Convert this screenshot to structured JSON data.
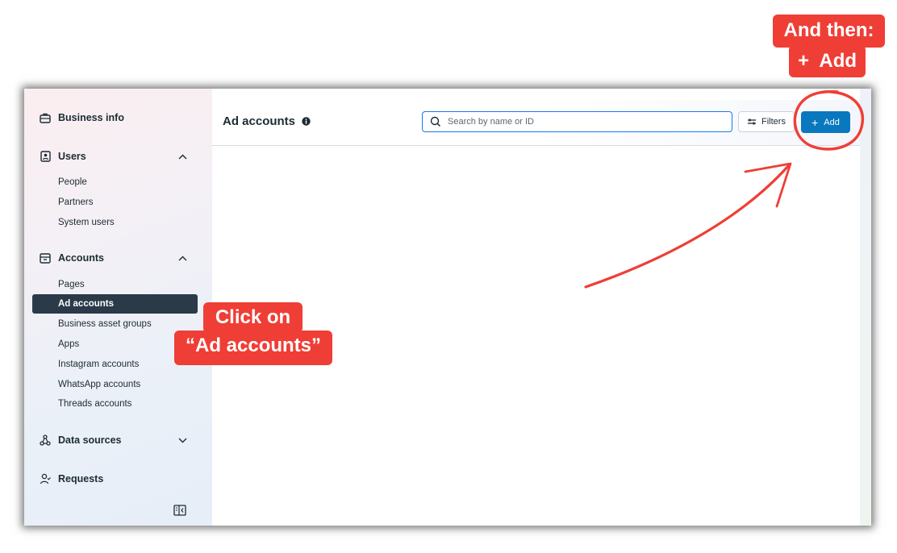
{
  "sidebar": {
    "business_info": "Business info",
    "users": {
      "label": "Users",
      "items": [
        "People",
        "Partners",
        "System users"
      ]
    },
    "accounts": {
      "label": "Accounts",
      "items": [
        "Pages",
        "Ad accounts",
        "Business asset groups",
        "Apps",
        "Instagram accounts",
        "WhatsApp accounts",
        "Threads accounts"
      ],
      "active_item": "Ad accounts"
    },
    "data_sources": "Data sources",
    "requests": "Requests"
  },
  "main": {
    "title": "Ad accounts",
    "search_placeholder": "Search by name or ID",
    "filters_label": "Filters",
    "add_label": "Add",
    "add_plus": "+"
  },
  "annotations": {
    "callout_left": {
      "line1": "Click on",
      "line2": "“Ad accounts”"
    },
    "callout_right": {
      "line1": "And then:",
      "line2": "+  Add"
    }
  },
  "colors": {
    "accent": "#0a78be",
    "annotation": "#ef3e36",
    "active_nav": "#2a3a48"
  },
  "icons": [
    "briefcase-icon",
    "user-badge-icon",
    "archive-icon",
    "data-sources-icon",
    "requests-icon",
    "chevron-up-icon",
    "chevron-down-icon",
    "collapse-sidebar-icon",
    "info-icon",
    "search-icon",
    "filter-sliders-icon"
  ]
}
